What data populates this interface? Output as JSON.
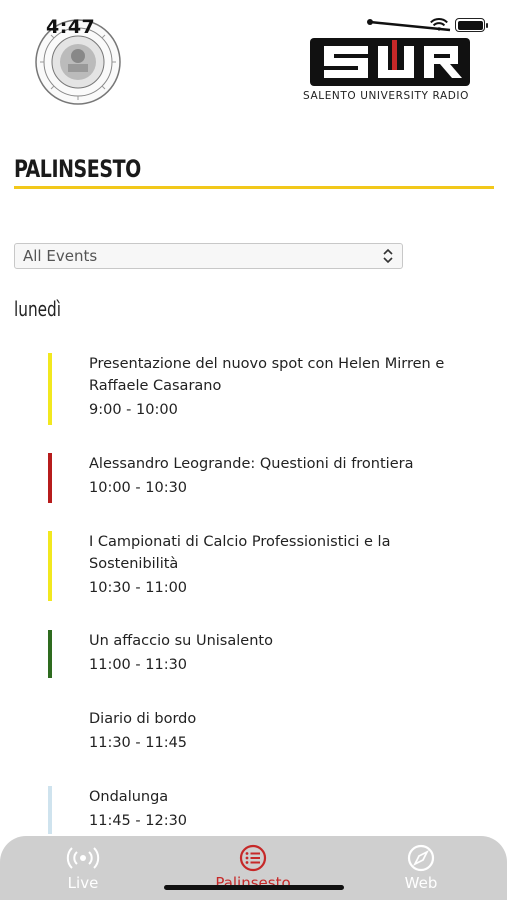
{
  "status_bar": {
    "time": "4:47"
  },
  "logo": {
    "seal": "university-seal",
    "radio_caption": "SALENTO UNIVERSITY RADIO"
  },
  "page": {
    "title": "PALINSESTO"
  },
  "filter": {
    "selected": "All Events"
  },
  "schedule": {
    "day": "lunedì",
    "events": [
      {
        "title": "Presentazione del nuovo spot con Helen Mirren e Raffaele Casarano",
        "time": "9:00 - 10:00",
        "color": "#f2e81f"
      },
      {
        "title": "Alessandro Leogrande: Questioni di frontiera",
        "time": "10:00 - 10:30",
        "color": "#b71c1c"
      },
      {
        "title": "I Campionati di Calcio Professionistici e la Sostenibilità",
        "time": "10:30 - 11:00",
        "color": "#f2e81f"
      },
      {
        "title": "Un affaccio su Unisalento",
        "time": "11:00 - 11:30",
        "color": "#2e6b1f"
      },
      {
        "title": "Diario di bordo",
        "time": "11:30 - 11:45",
        "color": ""
      },
      {
        "title": "Ondalunga",
        "time": "11:45 - 12:30",
        "color": "#cfe3ee"
      }
    ]
  },
  "tabbar": {
    "tabs": [
      {
        "label": "Live",
        "icon": "broadcast-icon"
      },
      {
        "label": "Palinsesto",
        "icon": "list-icon",
        "active": true
      },
      {
        "label": "Web",
        "icon": "compass-icon"
      }
    ]
  },
  "colors": {
    "accent": "#f2c81a",
    "active_tab": "#c62828",
    "tabbar_bg": "#cfcfcf"
  }
}
